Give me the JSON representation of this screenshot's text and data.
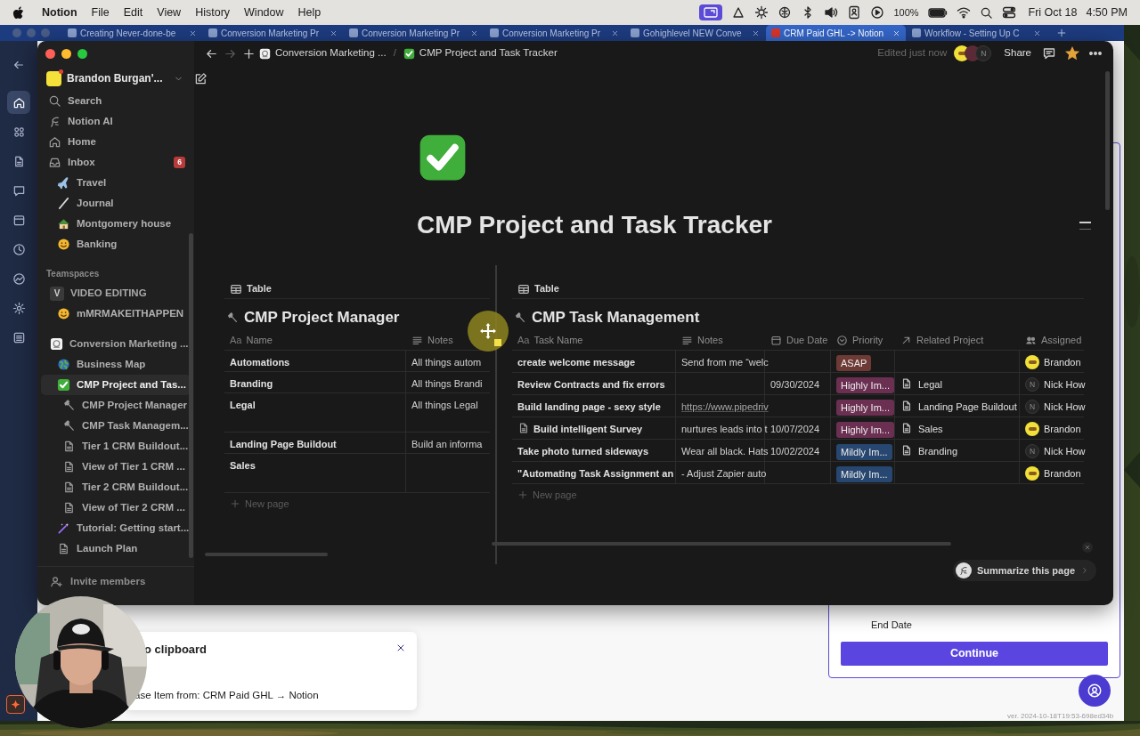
{
  "menubar": {
    "app": "Notion",
    "menus": [
      "File",
      "Edit",
      "View",
      "History",
      "Window",
      "Help"
    ],
    "battery": "100%",
    "date": "Fri Oct 18",
    "time": "4:50 PM"
  },
  "browser_tabs": [
    {
      "title": "Creating Never-done-be",
      "selected": false
    },
    {
      "title": "Conversion Marketing Pr",
      "selected": false
    },
    {
      "title": "Conversion Marketing Pr",
      "selected": false
    },
    {
      "title": "Conversion Marketing Pr",
      "selected": false
    },
    {
      "title": "Gohighlevel NEW Conve",
      "selected": false
    },
    {
      "title": "CRM Paid GHL -> Notion",
      "selected": true
    },
    {
      "title": "Workflow - Setting Up C",
      "selected": false
    }
  ],
  "browser_sidebar": [
    {
      "kind": "home",
      "selected": true
    },
    {
      "kind": "apps",
      "selected": false
    },
    {
      "kind": "doc",
      "selected": false
    },
    {
      "kind": "chat",
      "selected": false
    },
    {
      "kind": "calendar",
      "selected": false
    },
    {
      "kind": "clock",
      "selected": false
    },
    {
      "kind": "chart",
      "selected": false
    },
    {
      "kind": "gear",
      "selected": false
    },
    {
      "kind": "list",
      "selected": false
    }
  ],
  "sidebar": {
    "workspace": "Brandon Burgan'...",
    "nav": [
      {
        "label": "Search",
        "kind": "search",
        "selected": false
      },
      {
        "label": "Notion AI",
        "kind": "ai",
        "selected": false
      },
      {
        "label": "Home",
        "kind": "home",
        "selected": false
      },
      {
        "label": "Inbox",
        "kind": "inbox",
        "selected": false,
        "badge": "6"
      }
    ],
    "pages": [
      {
        "label": "Travel",
        "kind": "airplane",
        "selected": false
      },
      {
        "label": "Journal",
        "kind": "pen",
        "selected": false
      },
      {
        "label": "Montgomery house",
        "kind": "house",
        "selected": false
      },
      {
        "label": "Banking",
        "kind": "smiley",
        "selected": false
      }
    ],
    "teamspaces_heading": "Teamspaces",
    "teamspaces": [
      {
        "label": "VIDEO EDITING",
        "kind": "letter",
        "icon_text": "V",
        "selected": false,
        "children": [
          {
            "label": "mMRMAKEITHAPPEN",
            "kind": "smiley",
            "selected": false
          }
        ]
      },
      {
        "label": "Conversion Marketing ...",
        "kind": "logo",
        "selected": false,
        "children": [
          {
            "label": "Business Map",
            "kind": "globe",
            "selected": false
          },
          {
            "label": "CMP Project and Tas...",
            "kind": "check",
            "selected": true,
            "children": [
              {
                "label": "CMP Project Manager",
                "kind": "hammer",
                "selected": false
              },
              {
                "label": "CMP Task Managem...",
                "kind": "hammer",
                "selected": false
              },
              {
                "label": "Tier 1 CRM Buildout...",
                "kind": "doc",
                "selected": false
              },
              {
                "label": "View of Tier 1 CRM ...",
                "kind": "doc",
                "selected": false
              },
              {
                "label": "Tier 2 CRM Buildout...",
                "kind": "doc",
                "selected": false
              },
              {
                "label": "View of Tier 2 CRM ...",
                "kind": "doc",
                "selected": false
              }
            ]
          },
          {
            "label": "Tutorial: Getting start...",
            "kind": "wand",
            "selected": false
          },
          {
            "label": "Launch Plan",
            "kind": "doc",
            "selected": false
          }
        ]
      }
    ],
    "footer": "Invite members"
  },
  "topbar": {
    "breadcrumb": [
      {
        "label": "Conversion Marketing ...",
        "kind": "logo"
      },
      {
        "label": "CMP Project and Task Tracker",
        "kind": "check"
      }
    ],
    "separator": "/",
    "edited": "Edited just now",
    "avatars": [
      {
        "kind": "badge"
      },
      {
        "kind": "plain",
        "color": "#5c2a36"
      },
      {
        "kind": "initial",
        "letter": "N"
      }
    ],
    "share": "Share",
    "favorite": true
  },
  "page": {
    "title": "CMP Project and Task Tracker",
    "tables": [
      {
        "view": "Table",
        "title": "CMP Project Manager",
        "columns": [
          {
            "label": "Name",
            "prefix": "Aa"
          },
          {
            "label": "Notes",
            "kind": "lines"
          }
        ],
        "rows": [
          {
            "tall": false,
            "cells": [
              {
                "kind": "title",
                "text": "Automations",
                "page_icon": false
              },
              {
                "kind": "text",
                "text": "All things autom"
              }
            ]
          },
          {
            "tall": false,
            "cells": [
              {
                "kind": "title",
                "text": "Branding",
                "page_icon": false
              },
              {
                "kind": "text",
                "text": "All things Brandi"
              }
            ]
          },
          {
            "tall": true,
            "cells": [
              {
                "kind": "title",
                "text": "Legal",
                "page_icon": false
              },
              {
                "kind": "text",
                "text": "All things Legal"
              }
            ]
          },
          {
            "tall": false,
            "cells": [
              {
                "kind": "title",
                "text": "Landing Page Buildout",
                "page_icon": false
              },
              {
                "kind": "text",
                "text": "Build an informa"
              }
            ]
          },
          {
            "tall": true,
            "cells": [
              {
                "kind": "title",
                "text": "Sales",
                "page_icon": false
              },
              {
                "kind": "empty"
              }
            ]
          }
        ],
        "new_row": "New page"
      },
      {
        "view": "Table",
        "title": "CMP Task Management",
        "columns": [
          {
            "label": "Task Name",
            "prefix": "Aa"
          },
          {
            "label": "Notes",
            "kind": "lines"
          },
          {
            "label": "Due Date",
            "kind": "calendar"
          },
          {
            "label": "Priority",
            "kind": "status"
          },
          {
            "label": "Related Project",
            "kind": "arrow"
          },
          {
            "label": "Assigned",
            "kind": "people"
          }
        ],
        "rows": [
          {
            "tall": false,
            "cells": [
              {
                "kind": "title",
                "text": "create welcome message",
                "page_icon": false
              },
              {
                "kind": "text",
                "text": "Send from me “welc"
              },
              {
                "kind": "empty"
              },
              {
                "kind": "tag",
                "text": "ASAP",
                "color": "#6e3a35"
              },
              {
                "kind": "empty"
              },
              {
                "kind": "person",
                "avatar": {
                  "kind": "badge"
                },
                "name": "Brandon"
              }
            ]
          },
          {
            "tall": false,
            "cells": [
              {
                "kind": "title",
                "text": "Review Contracts and fix errors",
                "page_icon": false
              },
              {
                "kind": "empty"
              },
              {
                "kind": "text",
                "text": "09/30/2024"
              },
              {
                "kind": "tag",
                "text": "Highly Im...",
                "color": "#6b2f52"
              },
              {
                "kind": "relation",
                "text": "Legal"
              },
              {
                "kind": "person",
                "avatar": {
                  "kind": "initial",
                  "letter": "N"
                },
                "name": "Nick How"
              }
            ]
          },
          {
            "tall": false,
            "cells": [
              {
                "kind": "title",
                "text": "Build landing page - sexy style",
                "page_icon": false
              },
              {
                "kind": "link",
                "text": "https://www.pipedriv"
              },
              {
                "kind": "empty"
              },
              {
                "kind": "tag",
                "text": "Highly Im...",
                "color": "#6b2f52"
              },
              {
                "kind": "relation",
                "text": "Landing Page Buildout"
              },
              {
                "kind": "person",
                "avatar": {
                  "kind": "initial",
                  "letter": "N"
                },
                "name": "Nick How"
              }
            ]
          },
          {
            "tall": false,
            "cells": [
              {
                "kind": "title",
                "text": "Build intelligent Survey",
                "page_icon": true
              },
              {
                "kind": "text",
                "text": "nurtures leads into t"
              },
              {
                "kind": "text",
                "text": "10/07/2024"
              },
              {
                "kind": "tag",
                "text": "Highly Im...",
                "color": "#6b2f52"
              },
              {
                "kind": "relation",
                "text": "Sales"
              },
              {
                "kind": "person",
                "avatar": {
                  "kind": "badge"
                },
                "name": "Brandon"
              }
            ]
          },
          {
            "tall": false,
            "cells": [
              {
                "kind": "title",
                "text": "Take photo turned sideways",
                "page_icon": false
              },
              {
                "kind": "text",
                "text": "Wear all black. Hats"
              },
              {
                "kind": "text",
                "text": "10/02/2024"
              },
              {
                "kind": "tag",
                "text": "Mildly Im...",
                "color": "#284770"
              },
              {
                "kind": "relation",
                "text": "Branding"
              },
              {
                "kind": "person",
                "avatar": {
                  "kind": "initial",
                  "letter": "N"
                },
                "name": "Nick How"
              }
            ]
          },
          {
            "tall": false,
            "cells": [
              {
                "kind": "title",
                "text": "\"Automating Task Assignment an",
                "page_icon": false
              },
              {
                "kind": "text",
                "text": "- Adjust Zapier auto"
              },
              {
                "kind": "empty"
              },
              {
                "kind": "tag",
                "text": "Mildly Im...",
                "color": "#284770"
              },
              {
                "kind": "empty"
              },
              {
                "kind": "person",
                "avatar": {
                  "kind": "badge"
                },
                "name": "Brandon"
              }
            ]
          }
        ],
        "new_row": "New page"
      }
    ]
  },
  "assistant": {
    "label": "Summarize this page"
  },
  "background_app": {
    "field_label": "End Date",
    "button": "Continue",
    "version": "ver. 2024-10-18T19:53-698ed34b"
  },
  "toast": {
    "title": "o clipboard",
    "message": "ase Item from: CRM Paid GHL → Notion"
  }
}
